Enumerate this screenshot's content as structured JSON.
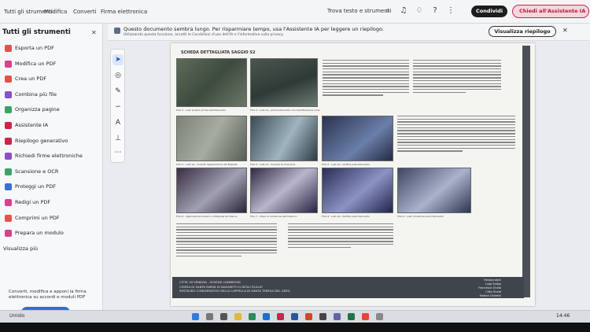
{
  "topbar": {
    "menu": [
      "Tutti gli strumenti",
      "Modifica",
      "Converti",
      "Firma elettronica"
    ],
    "search_tools": "Trova testo e strumenti",
    "share_label": "Condividi",
    "assistant_label": "Chiedi all'Assistente IA"
  },
  "tools_panel": {
    "title": "Tutti gli strumenti",
    "items": [
      {
        "label": "Esporta un PDF",
        "icon": "export-pdf-icon",
        "color": "#e2544a"
      },
      {
        "label": "Modifica un PDF",
        "icon": "edit-pdf-icon",
        "color": "#d9418c"
      },
      {
        "label": "Crea un PDF",
        "icon": "create-pdf-icon",
        "color": "#e2544a"
      },
      {
        "label": "Combina più file",
        "icon": "combine-files-icon",
        "color": "#8b4fc9"
      },
      {
        "label": "Organizza pagine",
        "icon": "organize-pages-icon",
        "color": "#3da364"
      },
      {
        "label": "Assistente IA",
        "icon": "ai-assistant-icon",
        "color": "#c8264a"
      },
      {
        "label": "Riepilogo generativo",
        "icon": "summary-icon",
        "color": "#c8264a"
      },
      {
        "label": "Richiedi firme elettroniche",
        "icon": "request-signatures-icon",
        "color": "#8b4fc9"
      },
      {
        "label": "Scansione e OCR",
        "icon": "scan-ocr-icon",
        "color": "#3da364"
      },
      {
        "label": "Proteggi un PDF",
        "icon": "protect-pdf-icon",
        "color": "#3b6fd4"
      },
      {
        "label": "Redigi un PDF",
        "icon": "redact-pdf-icon",
        "color": "#d9418c"
      },
      {
        "label": "Comprimi un PDF",
        "icon": "compress-pdf-icon",
        "color": "#e2544a"
      },
      {
        "label": "Prepara un modulo",
        "icon": "prepare-form-icon",
        "color": "#d9418c"
      },
      {
        "label": "Visualizza più",
        "icon": "",
        "color": "#777777"
      }
    ],
    "footer_text": "Converti, modifica e apponi la firma elettronica su accordi e moduli PDF",
    "trial_label": "Prova gratuita"
  },
  "banner": {
    "text": "Questo documento sembra lungo. Per risparmiare tempo, usa l'Assistente IA per leggere un riepilogo.",
    "sub": "Utilizzando questa funzione, accetti le Condizioni d'uso dell'IA e l'Informativa sulla privacy",
    "summary_label": "Visualizza riepilogo"
  },
  "document": {
    "heading": "SCHEDA DETTAGLIATA SAGGIO S2",
    "captions": [
      "Foto 1 - Lato sinistro prima dell'intervento",
      "Foto 2 - Lato sin. prima intervento con identificazione zone",
      "Foto 3 - Lato sin. durante l'applicazione del Bioplast",
      "Foto 4 - Lato sin. durante la rimozione",
      "Foto 5 - Lato sin. verifica post-intervento",
      "Foto 6 - Applicazione impacco di Bioplast all'interno",
      "Foto 7 - Dopo la rimozione dell'impacco",
      "Foto 8 - Lato sin. Verifica post intervento",
      "Foto 9 - Lato rimozione post-intervento"
    ],
    "footer_title": "CITTA' DI VENEZIA - SCHEDE CAMMEIODI\nCHIESA DI SANTA MARIA DI NAZARETH O DEGLI SCALZI\nRESTAURO CONSERVATIVO DELLA CAPPELLA DI SANTA TERESA DEL GESU'",
    "footer_credits": "Restauratori\nLuigi Soligo\nFrancesca Ghedi\nCitta Ghedi\nMatteo Ghidetti"
  },
  "taskbar": {
    "weather": "Umido",
    "clock": "14:46"
  }
}
